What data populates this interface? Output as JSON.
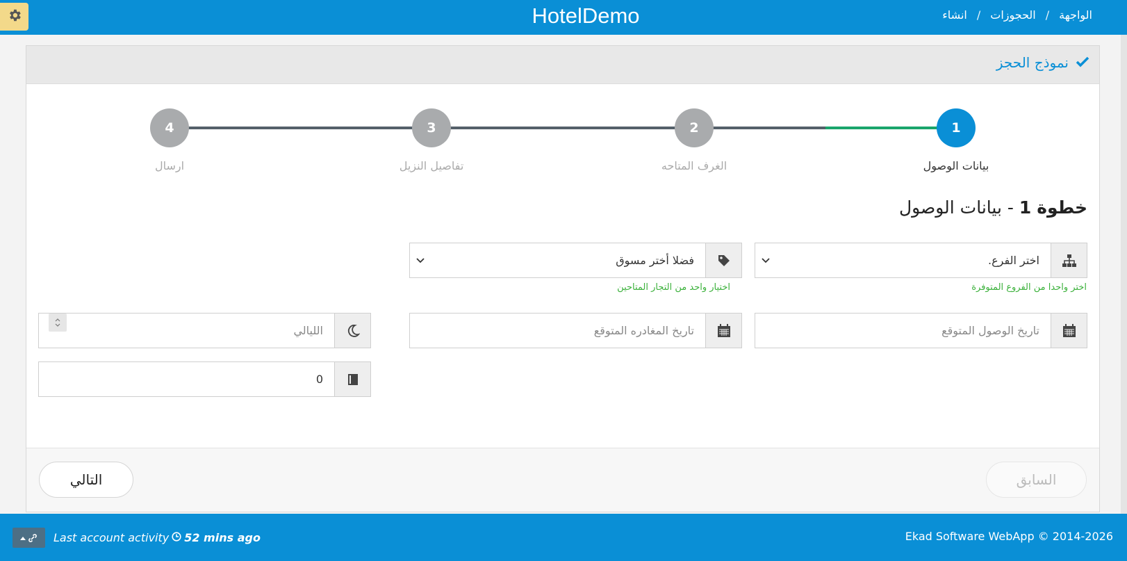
{
  "app": {
    "title": "HotelDemo"
  },
  "breadcrumb": [
    "الواجهة",
    "الحجوزات",
    "انشاء"
  ],
  "panel": {
    "title": "نموذج الحجز"
  },
  "steps": [
    {
      "number": "1",
      "label": "بيانات الوصول",
      "state": "active"
    },
    {
      "number": "2",
      "label": "الغرف المتاحه",
      "state": "pending"
    },
    {
      "number": "3",
      "label": "تفاصيل النزيل",
      "state": "pending"
    },
    {
      "number": "4",
      "label": "ارسال",
      "state": "pending"
    }
  ],
  "step_heading": {
    "prefix": "خطوة",
    "number": "1",
    "text": "- بيانات الوصول"
  },
  "form": {
    "branch": {
      "value": "اختر الفرع.",
      "hint": "اختر واحدا من الفروع المتوفرة"
    },
    "marketer": {
      "value": "فضلا أختر مسوق",
      "hint": "اختيار واحد من التجار المتاحين"
    },
    "arrival_date": {
      "placeholder": "تاريخ الوصول المتوقع"
    },
    "departure_date": {
      "placeholder": "تاريخ المغادره المتوقع"
    },
    "nights": {
      "placeholder": "الليالي"
    },
    "count": {
      "value": "0"
    }
  },
  "buttons": {
    "previous": "السابق",
    "next": "التالي"
  },
  "footer": {
    "activity_label": "Last account activity",
    "activity_value": "52 mins ago",
    "copyright": "Ekad Software WebApp © 2014-2026"
  },
  "colors": {
    "primary": "#0a8fd6",
    "step_progress": "#1aa56c",
    "step_pending": "#a9abad",
    "hint": "#3bb13b"
  }
}
